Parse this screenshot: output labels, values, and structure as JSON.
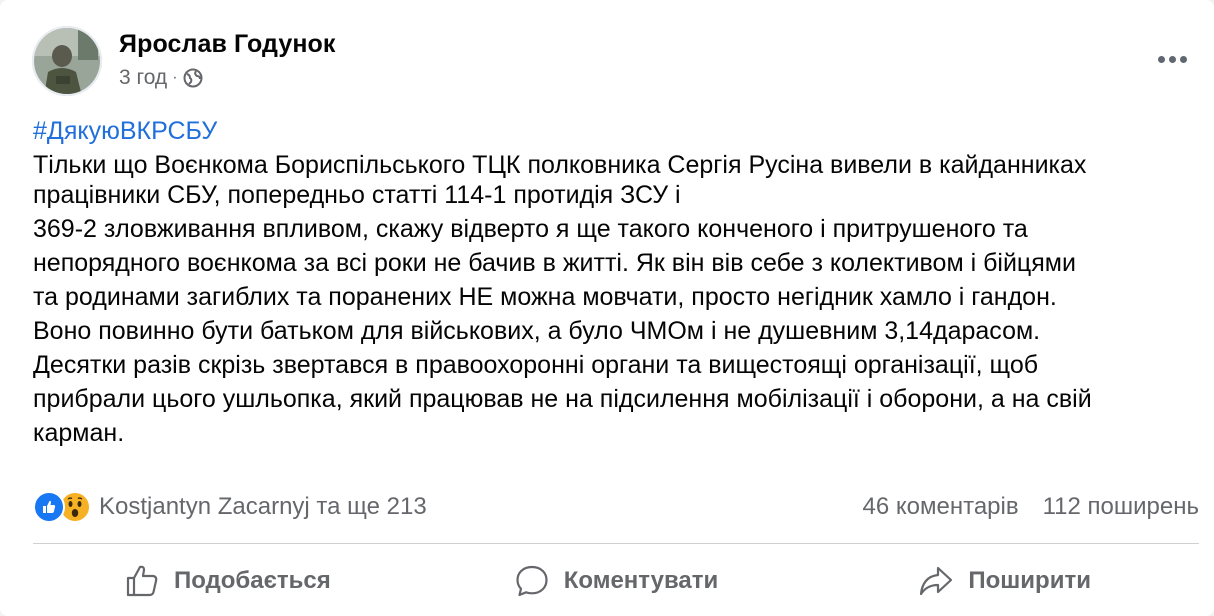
{
  "post": {
    "author_name": "Ярослав Годунок",
    "timestamp": "3 год",
    "separator": "·",
    "audience_icon": "globe-icon",
    "more_icon": "more-options-icon",
    "hashtag": "#ДякуюВКРСБУ",
    "body_lines": [
      "Тільки що Воєнкома Бориспільського ТЦК полковника Сергія Русіна вивели в кайданниках",
      "працівники СБУ, попередньо статті 114-1 протидія ЗСУ і",
      "369-2 зловживання впливом, скажу відверто я ще такого конченого і притрушеного та",
      "непорядного воєнкома за всі роки не бачив в житті. Як він вів себе з колективом і бійцями",
      "та родинами загиблих та поранених НЕ можна мовчати, просто негідник хамло і гандон.",
      "Воно повинно бути батьком для військових, а було ЧМОм і не душевним 3,14дарасом.",
      "Десятки разів скрізь звертався в правоохоронні органи та вищестоящі організації, щоб",
      "прибрали цього ушльопка, який працював не на підсилення мобілізації і оборони, а на свій",
      "карман."
    ]
  },
  "reactions": {
    "icons": [
      "like-reaction-icon",
      "wow-reaction-icon"
    ],
    "summary": "Kostjantyn Zacarnyj та ще 213",
    "comments": "46 коментарів",
    "shares": "112 поширень"
  },
  "actions": {
    "like_label": "Подобається",
    "comment_label": "Коментувати",
    "share_label": "Поширити"
  },
  "colors": {
    "hashtag": "#216fdb",
    "secondary_text": "#65676b",
    "like_blue": "#1877f2",
    "wow_yellow": "#f7b125"
  }
}
